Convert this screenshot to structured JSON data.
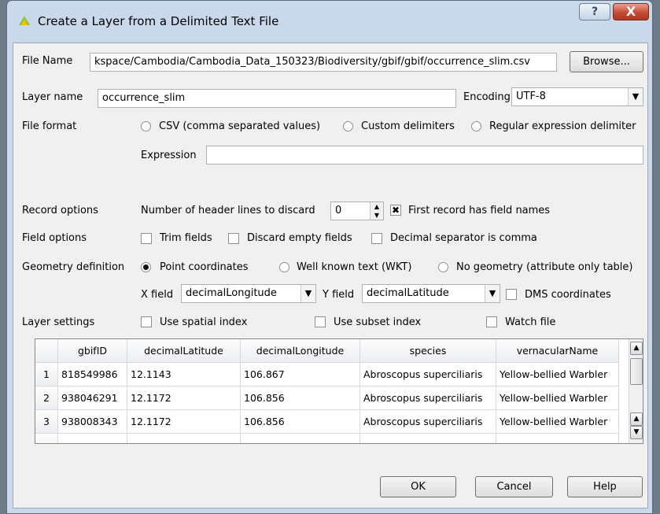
{
  "window": {
    "title": "Create a Layer from a Delimited Text File",
    "help_glyph": "?",
    "close_glyph": "X"
  },
  "file": {
    "label": "File Name",
    "value": "kspace/Cambodia/Cambodia_Data_150323/Biodiversity/gbif/gbif/occurrence_slim.csv",
    "browse_label": "Browse..."
  },
  "layer": {
    "label": "Layer name",
    "value": "occurrence_slim",
    "encoding_label": "Encoding",
    "encoding_value": "UTF-8"
  },
  "file_format": {
    "label": "File format",
    "options": [
      "CSV (comma separated values)",
      "Custom delimiters",
      "Regular expression delimiter"
    ],
    "expression_label": "Expression",
    "expression_value": ""
  },
  "record_options": {
    "label": "Record options",
    "header_lines_label": "Number of header lines to discard",
    "header_lines_value": "0",
    "first_record_label": "First record has field names",
    "first_record_checked": true
  },
  "field_options": {
    "label": "Field options",
    "trim_label": "Trim fields",
    "discard_label": "Discard empty fields",
    "decimal_label": "Decimal separator is comma"
  },
  "geometry": {
    "label": "Geometry definition",
    "options": [
      "Point coordinates",
      "Well known text (WKT)",
      "No geometry (attribute only table)"
    ],
    "x_label": "X field",
    "x_value": "decimalLongitude",
    "y_label": "Y field",
    "y_value": "decimalLatitude",
    "dms_label": "DMS coordinates"
  },
  "layer_settings": {
    "label": "Layer settings",
    "spatial_label": "Use spatial index",
    "subset_label": "Use subset index",
    "watch_label": "Watch file"
  },
  "table": {
    "headers": [
      "gbifID",
      "decimalLatitude",
      "decimalLongitude",
      "species",
      "vernacularName"
    ],
    "rows": [
      {
        "n": "1",
        "cells": [
          "818549986",
          "12.1143",
          "106.867",
          "Abroscopus superciliaris",
          "Yellow-bellied Warbler"
        ]
      },
      {
        "n": "2",
        "cells": [
          "938046291",
          "12.1172",
          "106.856",
          "Abroscopus superciliaris",
          "Yellow-bellied Warbler"
        ]
      },
      {
        "n": "3",
        "cells": [
          "938008343",
          "12.1172",
          "106.856",
          "Abroscopus superciliaris",
          "Yellow-bellied Warbler"
        ]
      }
    ]
  },
  "buttons": {
    "ok": "OK",
    "cancel": "Cancel",
    "help": "Help"
  }
}
